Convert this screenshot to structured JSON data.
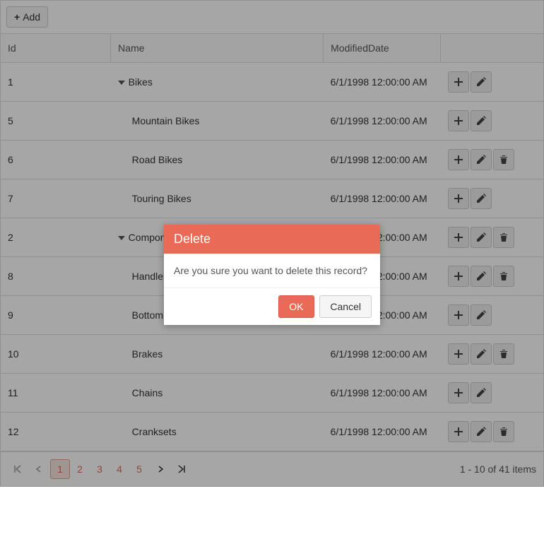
{
  "toolbar": {
    "add_label": "Add"
  },
  "columns": {
    "id": "Id",
    "name": "Name",
    "date": "ModifiedDate"
  },
  "rows": [
    {
      "id": "1",
      "name": "Bikes",
      "date": "6/1/1998 12:00:00 AM",
      "level": 0,
      "expanded": true,
      "actions": [
        "add",
        "edit"
      ]
    },
    {
      "id": "5",
      "name": "Mountain Bikes",
      "date": "6/1/1998 12:00:00 AM",
      "level": 1,
      "expanded": false,
      "actions": [
        "add",
        "edit"
      ]
    },
    {
      "id": "6",
      "name": "Road Bikes",
      "date": "6/1/1998 12:00:00 AM",
      "level": 1,
      "expanded": false,
      "actions": [
        "add",
        "edit",
        "delete"
      ]
    },
    {
      "id": "7",
      "name": "Touring Bikes",
      "date": "6/1/1998 12:00:00 AM",
      "level": 1,
      "expanded": false,
      "actions": [
        "add",
        "edit"
      ]
    },
    {
      "id": "2",
      "name": "Components",
      "date": "6/1/1998 12:00:00 AM",
      "level": 0,
      "expanded": true,
      "actions": [
        "add",
        "edit",
        "delete"
      ]
    },
    {
      "id": "8",
      "name": "Handlebars",
      "date": "6/1/1998 12:00:00 AM",
      "level": 1,
      "expanded": false,
      "actions": [
        "add",
        "edit",
        "delete"
      ]
    },
    {
      "id": "9",
      "name": "Bottom Brackets",
      "date": "6/1/1998 12:00:00 AM",
      "level": 1,
      "expanded": false,
      "actions": [
        "add",
        "edit"
      ]
    },
    {
      "id": "10",
      "name": "Brakes",
      "date": "6/1/1998 12:00:00 AM",
      "level": 1,
      "expanded": false,
      "actions": [
        "add",
        "edit",
        "delete"
      ]
    },
    {
      "id": "11",
      "name": "Chains",
      "date": "6/1/1998 12:00:00 AM",
      "level": 1,
      "expanded": false,
      "actions": [
        "add",
        "edit"
      ]
    },
    {
      "id": "12",
      "name": "Cranksets",
      "date": "6/1/1998 12:00:00 AM",
      "level": 1,
      "expanded": false,
      "actions": [
        "add",
        "edit",
        "delete"
      ]
    }
  ],
  "pager": {
    "pages": [
      "1",
      "2",
      "3",
      "4",
      "5"
    ],
    "active": "1",
    "info": "1 - 10 of 41 items"
  },
  "dialog": {
    "title": "Delete",
    "message": "Are you sure you want to delete this record?",
    "ok": "OK",
    "cancel": "Cancel"
  }
}
